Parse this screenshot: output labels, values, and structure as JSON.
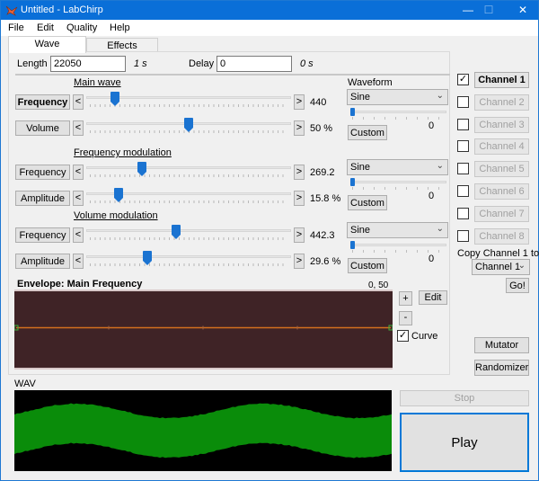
{
  "window": {
    "title": "Untitled - LabChirp",
    "controls": {
      "minimize": "—",
      "maximize": "☐",
      "close": "✕"
    },
    "title_bar_color": "#0a6fd8"
  },
  "menu": [
    "File",
    "Edit",
    "Quality",
    "Help"
  ],
  "tabs": [
    {
      "label": "Wave",
      "active": true
    },
    {
      "label": "Effects",
      "active": false
    }
  ],
  "length": {
    "label": "Length",
    "value": "22050",
    "unit_readout": "1 s"
  },
  "delay": {
    "label": "Delay",
    "value": "0",
    "unit_readout": "0 s"
  },
  "waveform_header": "Waveform",
  "sections": [
    {
      "heading": "Main wave",
      "rows": [
        {
          "button": "Frequency",
          "bold": true,
          "value": "440",
          "position": 0.14
        },
        {
          "button": "Volume",
          "bold": false,
          "value": "50 %",
          "position": 0.5
        }
      ],
      "waveform": {
        "selected": "Sine",
        "custom_label": "Custom",
        "slider_value": "0",
        "slider_position": 0
      }
    },
    {
      "heading": "Frequency modulation",
      "rows": [
        {
          "button": "Frequency",
          "bold": false,
          "value": "269.2",
          "position": 0.27
        },
        {
          "button": "Amplitude",
          "bold": false,
          "value": "15.8 %",
          "position": 0.16
        }
      ],
      "waveform": {
        "selected": "Sine",
        "custom_label": "Custom",
        "slider_value": "0",
        "slider_position": 0
      }
    },
    {
      "heading": "Volume modulation",
      "rows": [
        {
          "button": "Frequency",
          "bold": false,
          "value": "442.3",
          "position": 0.44
        },
        {
          "button": "Amplitude",
          "bold": false,
          "value": "29.6 %",
          "position": 0.3
        }
      ],
      "waveform": {
        "selected": "Sine",
        "custom_label": "Custom",
        "slider_value": "0",
        "slider_position": 0
      }
    }
  ],
  "arrows": {
    "left": "<",
    "right": ">"
  },
  "envelope": {
    "title": "Envelope: Main Frequency",
    "coords": "0, 50",
    "plus_label": "+",
    "minus_label": "-",
    "edit_label": "Edit",
    "curve_label": "Curve",
    "curve_checked": true,
    "line_level": 0.5,
    "background_color": "#3f2326",
    "line_color": "#d4701e"
  },
  "channels": [
    {
      "label": "Channel 1",
      "checked": true,
      "active": true
    },
    {
      "label": "Channel 2",
      "checked": false,
      "active": false
    },
    {
      "label": "Channel 3",
      "checked": false,
      "active": false
    },
    {
      "label": "Channel 4",
      "checked": false,
      "active": false
    },
    {
      "label": "Channel 5",
      "checked": false,
      "active": false
    },
    {
      "label": "Channel 6",
      "checked": false,
      "active": false
    },
    {
      "label": "Channel 7",
      "checked": false,
      "active": false
    },
    {
      "label": "Channel 8",
      "checked": false,
      "active": false
    }
  ],
  "copy": {
    "label": "Copy Channel 1 to:",
    "selected": "Channel 1",
    "go_label": "Go!"
  },
  "mutator_label": "Mutator",
  "randomizer_label": "Randomizer",
  "wav": {
    "label": "WAV",
    "wave_color": "#0a8c0a"
  },
  "stop_label": "Stop",
  "play_label": "Play"
}
